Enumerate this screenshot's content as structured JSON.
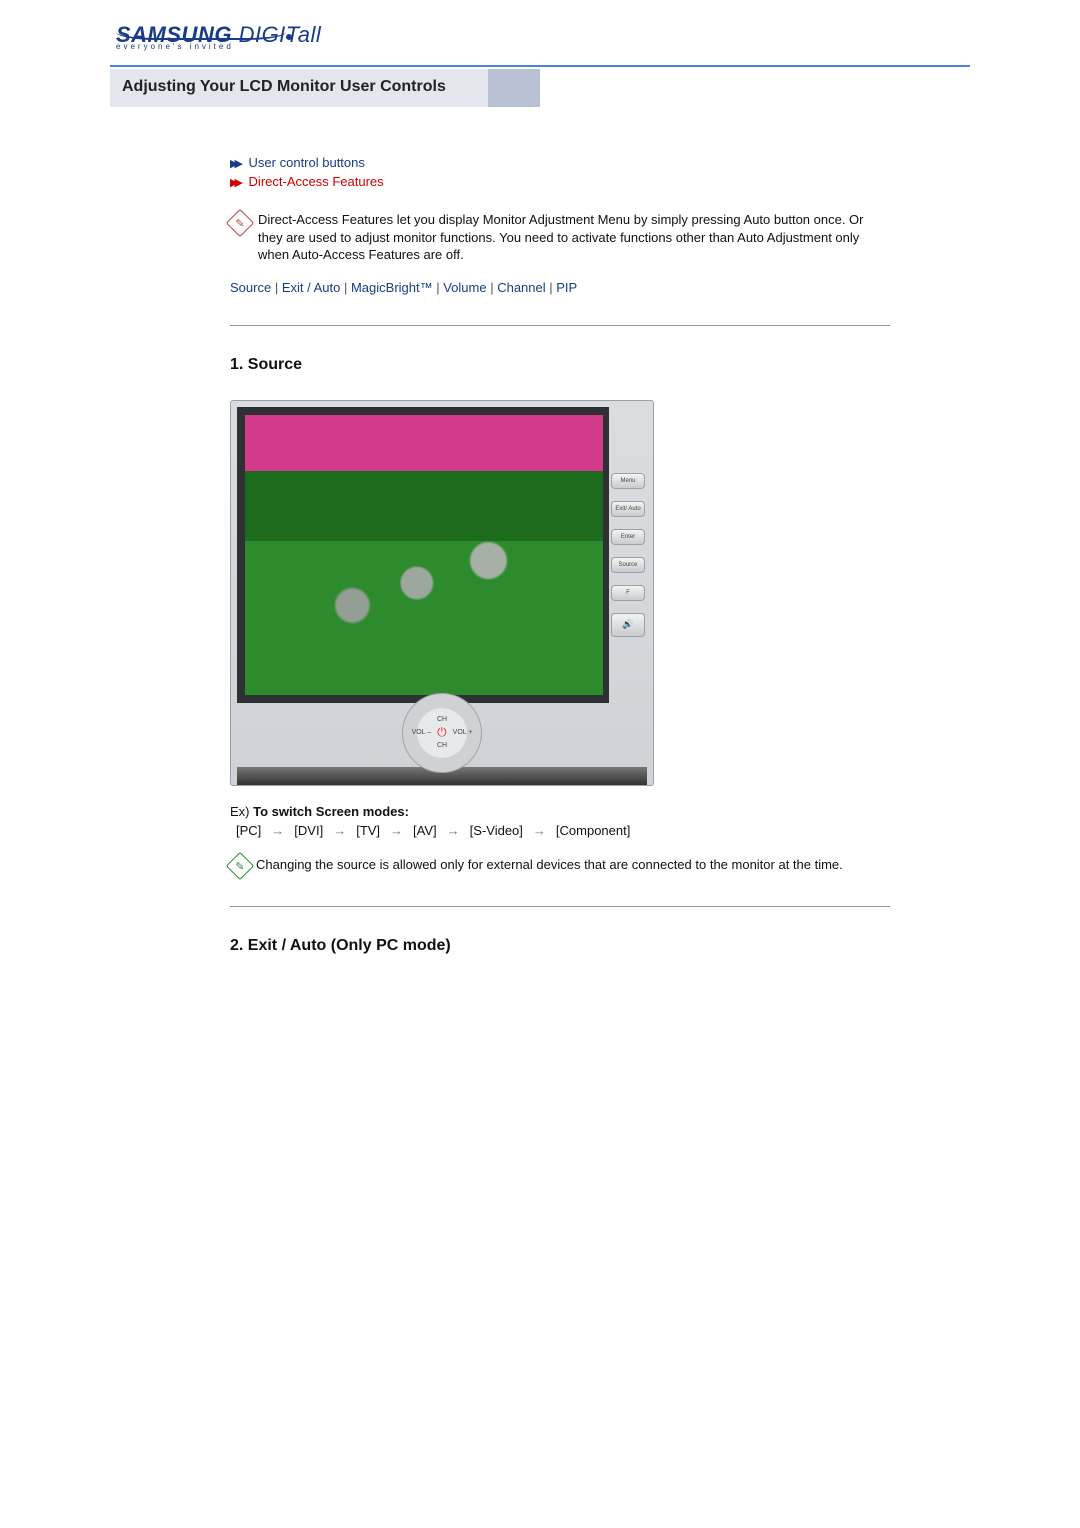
{
  "brand": {
    "name_head": "SAMSUNG ",
    "name_tail": "DIGITall",
    "tagline": "everyone's invited"
  },
  "title": "Adjusting Your LCD Monitor User Controls",
  "subnav": {
    "user_controls": "User control buttons",
    "direct_access": "Direct-Access Features"
  },
  "intro": "Direct-Access Features let you display Monitor Adjustment Menu by simply pressing Auto button once. Or they are used to adjust monitor functions. You need to activate functions other than Auto Adjustment only when Auto-Access Features are off.",
  "jump": {
    "items": [
      "Source",
      "Exit / Auto",
      "MagicBright™",
      "Volume",
      "Channel",
      "PIP"
    ],
    "sep": " | "
  },
  "sections": {
    "s1": "1. Source",
    "s2": "2. Exit / Auto (Only PC mode)"
  },
  "monitor": {
    "side": [
      "Menu",
      "Exit/\nAuto",
      "Enter",
      "Source",
      "F"
    ],
    "ring": {
      "top": "CH",
      "left": "VOL –",
      "right": "VOL +",
      "bottom": "CH",
      "power": "⏻"
    }
  },
  "example": {
    "prefix": "Ex) ",
    "label": "To switch Screen modes:",
    "seq": [
      "[PC]",
      "[DVI]",
      "[TV]",
      "[AV]",
      "[S-Video]",
      "[Component]"
    ],
    "arrow": "→"
  },
  "note": "Changing the source is allowed only for external devices that are connected to the monitor at the time."
}
